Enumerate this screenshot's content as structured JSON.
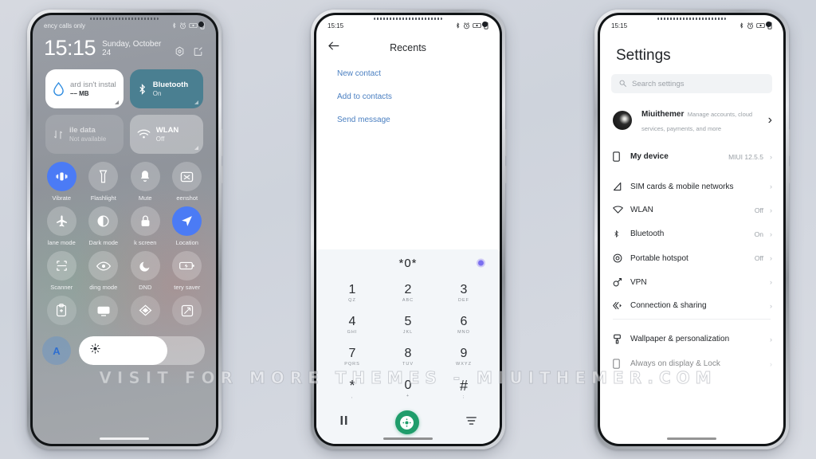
{
  "watermark": "VISIT FOR MORE THEMES - MIUITHEMER.COM",
  "phone1": {
    "status": {
      "carrier": "ency calls only"
    },
    "clock": {
      "time": "15:15",
      "date": "Sunday, October 24"
    },
    "cards": [
      {
        "title": "ard isn't instal",
        "sub": "–– MB",
        "style": "white",
        "icon": "water-drop-icon"
      },
      {
        "title": "Bluetooth",
        "sub": "On",
        "style": "teal",
        "icon": "bluetooth-icon"
      },
      {
        "title": "ile data",
        "sub": "Not available",
        "style": "dim",
        "icon": "mobile-data-icon"
      },
      {
        "title": "WLAN",
        "sub": "Off",
        "style": "grey",
        "icon": "wifi-icon"
      }
    ],
    "tiles": [
      {
        "label": "Vibrate",
        "icon": "vibrate-icon",
        "state": "on"
      },
      {
        "label": "Flashlight",
        "icon": "flashlight-icon",
        "state": "off"
      },
      {
        "label": "Mute",
        "icon": "bell-icon",
        "state": "off"
      },
      {
        "label": "eenshot",
        "icon": "screenshot-icon",
        "state": "off"
      },
      {
        "label": "lane mode",
        "icon": "airplane-icon",
        "state": "off"
      },
      {
        "label": "Dark mode",
        "icon": "contrast-icon",
        "state": "off"
      },
      {
        "label": "k screen",
        "icon": "lock-icon",
        "state": "off"
      },
      {
        "label": "Location",
        "icon": "location-icon",
        "state": "on"
      },
      {
        "label": "Scanner",
        "icon": "scan-icon",
        "state": "off"
      },
      {
        "label": "ding mode",
        "icon": "eye-icon",
        "state": "off"
      },
      {
        "label": "DND",
        "icon": "moon-icon",
        "state": "off"
      },
      {
        "label": "tery saver",
        "icon": "battery-saver-icon",
        "state": "off"
      },
      {
        "label": "",
        "icon": "clipboard-icon",
        "state": "faint"
      },
      {
        "label": "",
        "icon": "cast-icon",
        "state": "faint"
      },
      {
        "label": "",
        "icon": "nfc-icon",
        "state": "faint"
      },
      {
        "label": "",
        "icon": "sync-icon",
        "state": "faint"
      }
    ],
    "brightness": {
      "auto_label": "A",
      "level_percent": 70,
      "icon": "sun-icon"
    }
  },
  "phone2": {
    "status": {
      "time": "15:15"
    },
    "appbar": {
      "back_icon": "back-arrow-icon",
      "title": "Recents"
    },
    "options": [
      {
        "label": "New contact"
      },
      {
        "label": "Add to contacts"
      },
      {
        "label": "Send message"
      }
    ],
    "dialpad": {
      "entered_number": "*0*",
      "keys": [
        {
          "digit": "1",
          "letters": "QZ"
        },
        {
          "digit": "2",
          "letters": "ABC"
        },
        {
          "digit": "3",
          "letters": "DEF"
        },
        {
          "digit": "4",
          "letters": "GHI"
        },
        {
          "digit": "5",
          "letters": "JKL"
        },
        {
          "digit": "6",
          "letters": "MNO"
        },
        {
          "digit": "7",
          "letters": "PQRS"
        },
        {
          "digit": "8",
          "letters": "TUV"
        },
        {
          "digit": "9",
          "letters": "WXYZ"
        },
        {
          "digit": "*",
          "letters": ","
        },
        {
          "digit": "0",
          "letters": "+"
        },
        {
          "digit": "#",
          "letters": ";"
        }
      ],
      "left_icon": "pause-icon",
      "call_icon": "dialpad-call-icon",
      "right_icon": "sim-select-icon",
      "accent": "#1f9d6b"
    }
  },
  "phone3": {
    "status": {
      "time": "15:15"
    },
    "title": "Settings",
    "search": {
      "placeholder": "Search settings",
      "icon": "search-icon"
    },
    "account": {
      "name": "Miuithemer",
      "subtitle": "Manage accounts, cloud services, payments, and more",
      "chevron": "›"
    },
    "rows": [
      {
        "label": "My device",
        "value": "MIUI 12.5.5",
        "icon": "device-icon",
        "bold": true
      },
      {
        "label": "SIM cards & mobile networks",
        "value": "",
        "icon": "signal-icon",
        "bold": false
      },
      {
        "label": "WLAN",
        "value": "Off",
        "icon": "wifi-icon",
        "bold": false
      },
      {
        "label": "Bluetooth",
        "value": "On",
        "icon": "bluetooth-icon",
        "bold": false
      },
      {
        "label": "Portable hotspot",
        "value": "Off",
        "icon": "hotspot-icon",
        "bold": false
      },
      {
        "label": "VPN",
        "value": "",
        "icon": "vpn-icon",
        "bold": false
      },
      {
        "label": "Connection & sharing",
        "value": "",
        "icon": "share-icon",
        "bold": false
      },
      {
        "label": "Wallpaper & personalization",
        "value": "",
        "icon": "brush-icon",
        "bold": false
      },
      {
        "label": "Always on display & Lock",
        "value": "",
        "icon": "aod-icon",
        "bold": false
      }
    ],
    "chevron": "›"
  }
}
